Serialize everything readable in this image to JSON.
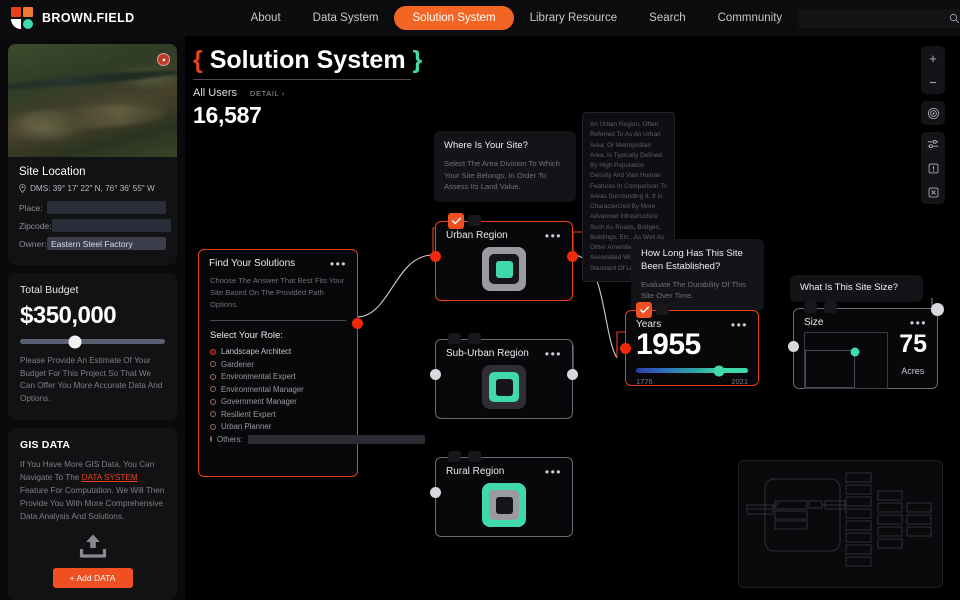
{
  "navbar": {
    "brand": "BROWN.FIELD",
    "links": [
      {
        "label": "About",
        "active": false
      },
      {
        "label": "Data System",
        "active": false
      },
      {
        "label": "Solution System",
        "active": true
      },
      {
        "label": "Library Resource",
        "active": false
      },
      {
        "label": "Search",
        "active": false
      },
      {
        "label": "Commnunity",
        "active": false
      }
    ],
    "search_placeholder": "",
    "search_value": "",
    "icons": {
      "search": "search-icon",
      "bell": "bell-icon",
      "avatar": "user-avatar"
    }
  },
  "sidebar": {
    "site": {
      "title": "Site Location",
      "dms": "DMS: 39° 17' 22\" N, 76° 36' 55\" W",
      "fields": [
        {
          "label": "Place:",
          "value": "",
          "name": "place-field"
        },
        {
          "label": "Zipcode:",
          "value": "",
          "name": "zipcode-field"
        },
        {
          "label": "Owner:",
          "value": "Eastern Steel Factory",
          "name": "owner-field"
        }
      ]
    },
    "budget": {
      "title": "Total Budget",
      "amount": "$350,000",
      "slider_percent": 38,
      "note": "Please Provide An Estimate Of Your Budget For This Project So That We Can Offer You More Accurate Data And Options."
    },
    "gis": {
      "title": "GIS DATA",
      "note_before": "If You Have More GIS Data, You Can Navigate To The ",
      "link": "DATA SYSTEM",
      "note_after": " Feature For Computation. We Will Then Provide You With More Comprehensive Data Analysis And Solutions.",
      "upload_icon": "upload-icon",
      "button": "+ Add DATA"
    }
  },
  "main": {
    "title_left_brace": "{",
    "title": "Solution System",
    "title_right_brace": "}",
    "all_users_label": "All Users",
    "detail_label": "DETAIL",
    "user_count": "16,587"
  },
  "solutions_card": {
    "title": "Find Your Solutions",
    "description": "Choose The Answer That Best Fits Your Site Based On The Provided Path Options.",
    "role_prompt": "Select Your Role:",
    "roles": [
      {
        "label": "Landscape Architect",
        "selected": true
      },
      {
        "label": "Gardener",
        "selected": false
      },
      {
        "label": "Environmental Expert",
        "selected": false
      },
      {
        "label": "Environmental Manager",
        "selected": false
      },
      {
        "label": "Government Manager",
        "selected": false
      },
      {
        "label": "Resilient Expert",
        "selected": false
      },
      {
        "label": "Urban Planner",
        "selected": false
      },
      {
        "label": "Others:",
        "selected": false,
        "has_input": true,
        "value": ""
      }
    ]
  },
  "tips": {
    "site_location": {
      "title": "Where Is Your Site?",
      "body": "Select The Area Division To Which Your Site Belongs, In Order To Assess Its Land Value."
    },
    "established": {
      "title": "How Long Has This Site Been Established?",
      "body": "Evaluate The Durability Of This Site Over Time."
    },
    "site_size": {
      "title": "What Is This Site Size?",
      "body": ""
    }
  },
  "urban_definition": "An Urban Region, Often Referred To As An Urban Area, Or Metropolitan Area, Is Typically Defined By High Population Density And Vast Human Features In Comparison To Areas Surrounding It. It Is Characterized By More Advanced Infrastructure Such As Roads, Bridges, Buildings, Etc., As Well As Other Amenities Associated With A Higher Standard Of Living.",
  "nodes": [
    {
      "label": "Urban Region",
      "selected": true,
      "menu": "•••"
    },
    {
      "label": "Sub-Urban Region",
      "selected": false,
      "menu": "•••"
    },
    {
      "label": "Rural Region",
      "selected": false,
      "menu": "•••"
    }
  ],
  "years_card": {
    "label": "Years",
    "value": "1955",
    "min": "1776",
    "max": "2021",
    "knob_percent": 74,
    "menu": "•••",
    "selected": true
  },
  "size_card": {
    "label": "Size",
    "value": "75",
    "unit": "Acres",
    "menu": "•••",
    "selected": false
  },
  "toolbar": [
    {
      "name": "zoom-in-icon",
      "glyph": "+"
    },
    {
      "name": "zoom-out-icon",
      "glyph": "−"
    },
    {
      "name": "target-icon",
      "glyph": "◎"
    },
    {
      "name": "settings-sliders-icon",
      "glyph": "⚙"
    },
    {
      "name": "alert-icon",
      "glyph": "!"
    },
    {
      "name": "close-icon",
      "glyph": "×"
    }
  ],
  "colors": {
    "accent_orange": "#f04f22",
    "accent_red": "#e8401c",
    "accent_teal": "#3fd9ab",
    "background": "#000000",
    "panel": "#121214"
  }
}
